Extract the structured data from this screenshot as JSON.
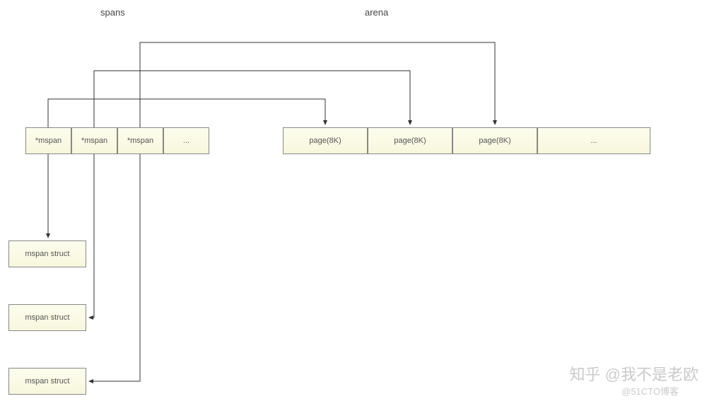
{
  "headings": {
    "spans": "spans",
    "arena": "arena"
  },
  "spans_row": {
    "cells": [
      "*mspan",
      "*mspan",
      "*mspan",
      "..."
    ]
  },
  "arena_row": {
    "cells": [
      "page(8K)",
      "page(8K)",
      "page(8K)",
      "..."
    ]
  },
  "structs": {
    "s1": "mspan struct",
    "s2": "mspan struct",
    "s3": "mspan struct"
  },
  "watermark": {
    "line1": "知乎 @我不是老欧",
    "line2": "@51CTO博客"
  }
}
